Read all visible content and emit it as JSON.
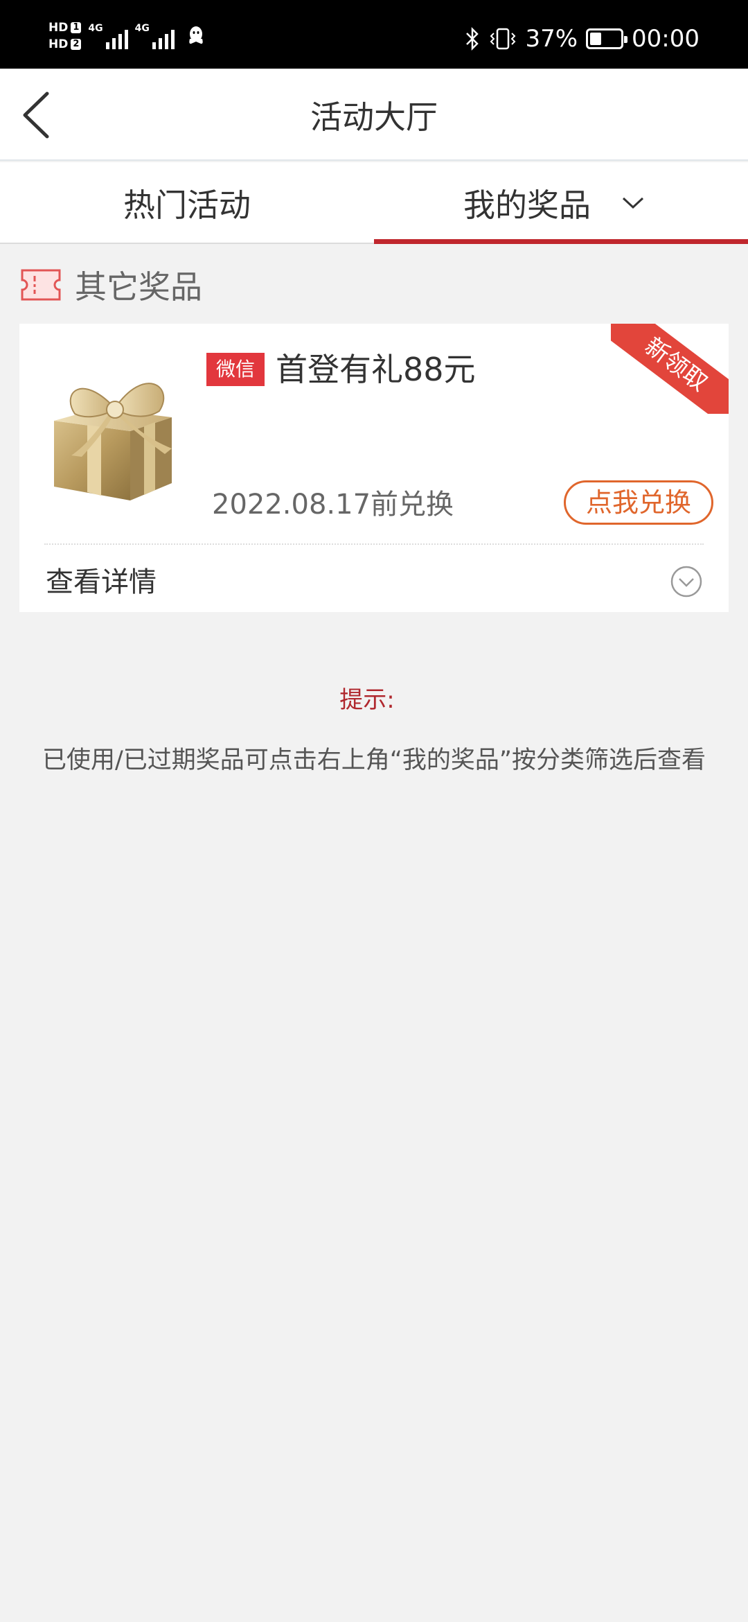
{
  "status_bar": {
    "hd1": "HD",
    "hd1_num": "1",
    "hd2": "HD",
    "hd2_num": "2",
    "net1": "4G",
    "net2": "4G",
    "battery_percent": "37%",
    "battery_level": 0.37,
    "time": "00:00",
    "icons": [
      "bluetooth-icon",
      "vibrate-icon",
      "battery-icon",
      "qq-icon"
    ]
  },
  "header": {
    "title": "活动大厅"
  },
  "tabs": {
    "items": [
      {
        "label": "热门活动",
        "active": false
      },
      {
        "label": "我的奖品",
        "active": true
      }
    ],
    "accent_color": "#c0272d"
  },
  "section": {
    "title": "其它奖品"
  },
  "prize_card": {
    "channel_tag": "微信",
    "title": "首登有礼88元",
    "ribbon": "新领取",
    "expiry": "2022.08.17前兑换",
    "redeem_label": "点我兑换",
    "details_label": "查看详情",
    "image": "gold-gift-box"
  },
  "tip": {
    "title": "提示:",
    "text": "已使用/已过期奖品可点击右上角“我的奖品”按分类筛选后查看"
  }
}
